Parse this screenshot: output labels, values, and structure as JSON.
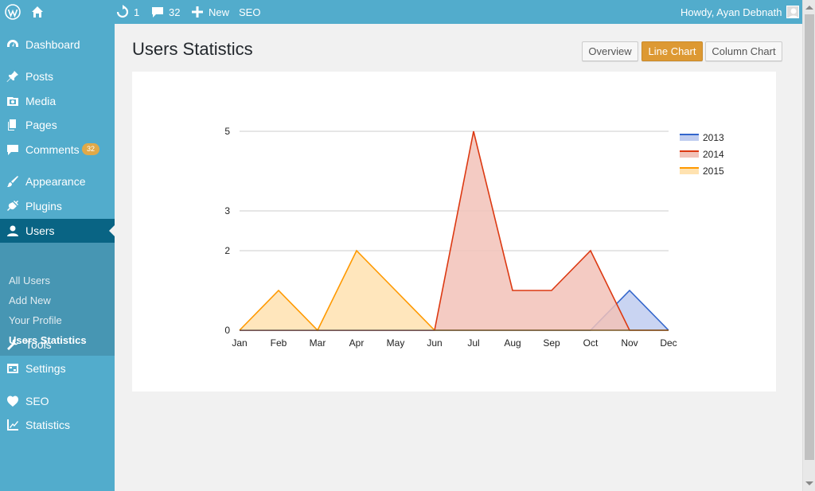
{
  "admin_bar": {
    "updates_count": "1",
    "comments_count": "32",
    "new_label": "New",
    "seo_label": "SEO",
    "greeting": "Howdy, Ayan Debnath"
  },
  "sidebar": {
    "items": [
      {
        "label": "Dashboard",
        "icon": "dashboard-icon"
      },
      {
        "label": "Posts",
        "icon": "pin-icon"
      },
      {
        "label": "Media",
        "icon": "media-icon"
      },
      {
        "label": "Pages",
        "icon": "pages-icon"
      },
      {
        "label": "Comments",
        "icon": "comment-icon",
        "badge": "32"
      },
      {
        "label": "Appearance",
        "icon": "brush-icon"
      },
      {
        "label": "Plugins",
        "icon": "plug-icon"
      },
      {
        "label": "Users",
        "icon": "user-icon"
      },
      {
        "label": "Tools",
        "icon": "wrench-icon"
      },
      {
        "label": "Settings",
        "icon": "settings-icon"
      },
      {
        "label": "SEO",
        "icon": "seo-icon"
      },
      {
        "label": "Statistics",
        "icon": "chart-icon"
      }
    ],
    "users_submenu": [
      "All Users",
      "Add New",
      "Your Profile",
      "Users Statistics"
    ]
  },
  "main": {
    "title": "Users Statistics",
    "tabs": [
      "Overview",
      "Line Chart",
      "Column Chart"
    ],
    "active_tab": "Line Chart"
  },
  "chart_data": {
    "type": "area",
    "categories": [
      "Jan",
      "Feb",
      "Mar",
      "Apr",
      "May",
      "Jun",
      "Jul",
      "Aug",
      "Sep",
      "Oct",
      "Nov",
      "Dec"
    ],
    "y_ticks": [
      "0",
      "2",
      "3",
      "5"
    ],
    "ylim": [
      0,
      5.3
    ],
    "legend_position": "right",
    "series": [
      {
        "name": "2013",
        "color": "#3366cc",
        "fill": "#c0cdf0",
        "values": [
          0,
          0,
          0,
          0,
          0,
          0,
          0,
          0,
          0,
          0,
          1,
          0
        ]
      },
      {
        "name": "2014",
        "color": "#dc3912",
        "fill": "#f2c2b8",
        "values": [
          0,
          0,
          0,
          0,
          0,
          0,
          5,
          1,
          1,
          2,
          0,
          0
        ]
      },
      {
        "name": "2015",
        "color": "#ff9900",
        "fill": "#ffe2b0",
        "values": [
          0,
          1,
          0,
          2,
          1,
          0,
          0,
          0,
          0,
          0,
          0,
          0
        ]
      }
    ]
  }
}
